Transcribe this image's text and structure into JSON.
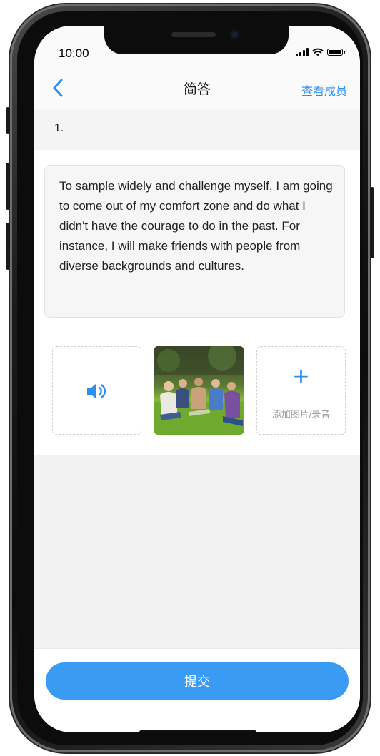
{
  "status_bar": {
    "time": "10:00"
  },
  "nav": {
    "title": "简答",
    "right_link": "查看成员"
  },
  "question": {
    "number": "1."
  },
  "answer": {
    "text": "To sample widely and challenge myself, I am going to come out of my comfort zone and do what I didn't have the courage to do in the past. For instance, I will make friends with people from diverse backgrounds and cultures."
  },
  "media": {
    "add_icon": "+",
    "add_label": "添加图片/录音",
    "audio_icon": "speaker-icon",
    "photo": "group-of-students-on-grass"
  },
  "footer": {
    "submit_label": "提交"
  },
  "colors": {
    "accent": "#2c8ff0",
    "button": "#3a9bf2",
    "background": "#f2f2f2"
  }
}
